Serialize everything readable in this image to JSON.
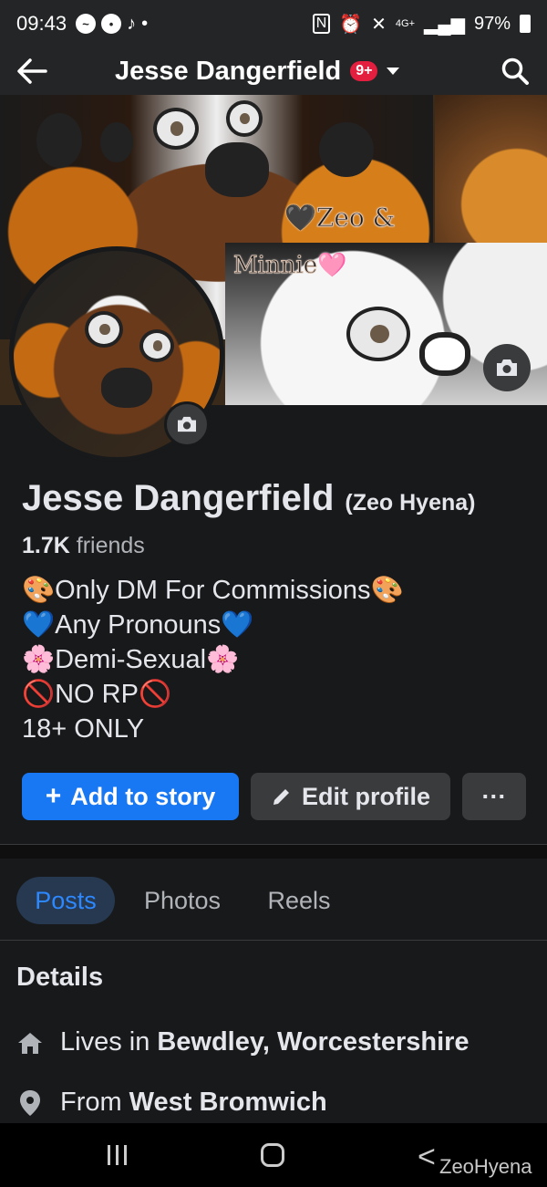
{
  "status_bar": {
    "time": "09:43",
    "network": "4G+",
    "battery": "97%"
  },
  "nav": {
    "title": "Jesse Dangerfield",
    "notification_badge": "9+"
  },
  "cover": {
    "overlay_line1": "Zeo &",
    "overlay_line2": "Minnie",
    "heart_black": "🖤",
    "heart_pink": "🩷"
  },
  "profile": {
    "name": "Jesse Dangerfield",
    "alt_name": "(Zeo Hyena)",
    "friends_count": "1.7K",
    "friends_label": "friends",
    "bio": [
      "🎨Only DM For Commissions🎨",
      "💙Any Pronouns💙",
      "🌸Demi-Sexual🌸",
      "🚫NO RP🚫",
      "18+ ONLY"
    ]
  },
  "actions": {
    "add_story_label": "Add to story",
    "add_story_plus": "+",
    "edit_profile_label": "Edit profile",
    "more_label": "···"
  },
  "tabs": [
    {
      "label": "Posts",
      "active": true
    },
    {
      "label": "Photos",
      "active": false
    },
    {
      "label": "Reels",
      "active": false
    }
  ],
  "details": {
    "title": "Details",
    "lives_prefix": "Lives in",
    "lives_value": "Bewdley, Worcestershire",
    "from_prefix": "From",
    "from_value": "West Bromwich"
  },
  "watermark": "ZeoHyena",
  "colors": {
    "accent": "#1877f2",
    "background": "#18191a",
    "surface": "#242526",
    "badge": "#e41e3f",
    "active_tab_bg": "#263951",
    "active_tab_text": "#2d88ff"
  },
  "icons": {
    "back": "arrow-left-icon",
    "search": "search-icon",
    "camera": "camera-icon",
    "edit": "pencil-icon",
    "home": "house-icon",
    "location": "location-pin-icon"
  }
}
